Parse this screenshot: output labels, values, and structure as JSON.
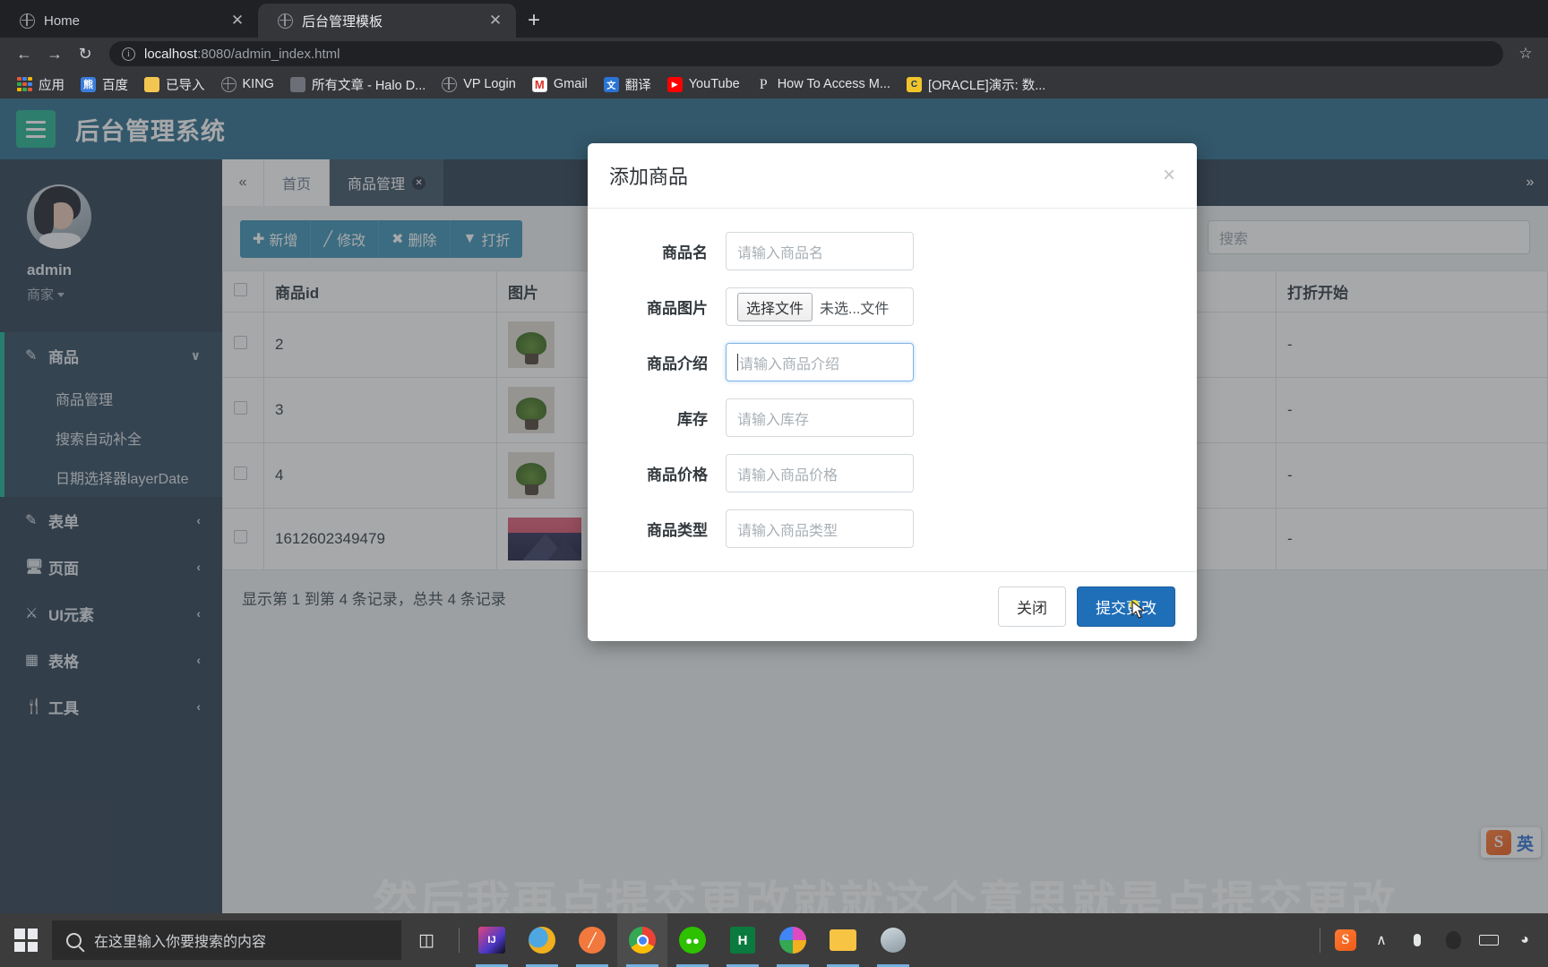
{
  "browser": {
    "tabs": [
      {
        "title": "Home",
        "active": false,
        "favicon": "globe-icon",
        "close": "✕"
      },
      {
        "title": "后台管理模板",
        "active": true,
        "favicon": "globe-icon",
        "close": "✕"
      }
    ],
    "new_tab_label": "+",
    "nav": {
      "back": "←",
      "forward": "→",
      "reload": "↻",
      "star": "☆"
    },
    "omnibox": {
      "host": "localhost",
      "path": ":8080/admin_index.html",
      "info_icon": "info-icon"
    },
    "bookmarks": [
      {
        "label": "应用",
        "icon": "apps-grid-icon"
      },
      {
        "label": "百度",
        "icon": "baidu-icon"
      },
      {
        "label": "已导入",
        "icon": "folder-icon"
      },
      {
        "label": "KING",
        "icon": "globe-icon"
      },
      {
        "label": "所有文章 - Halo D...",
        "icon": "photo-icon"
      },
      {
        "label": "VP Login",
        "icon": "globe-icon"
      },
      {
        "label": "Gmail",
        "icon": "gmail-icon"
      },
      {
        "label": "翻译",
        "icon": "translate-icon"
      },
      {
        "label": "YouTube",
        "icon": "youtube-icon"
      },
      {
        "label": "How To Access M...",
        "icon": "p-letter-icon"
      },
      {
        "label": "[ORACLE]演示: 数...",
        "icon": "oracle-icon"
      }
    ]
  },
  "app": {
    "brand": "后台管理系统",
    "hamburger_icon": "hamburger-icon",
    "sidebar": {
      "user": {
        "name": "admin",
        "role": "商家",
        "avatar": "user-avatar"
      },
      "nav": [
        {
          "label": "商品",
          "icon": "edit-square-icon",
          "arrow": "∨",
          "open": true,
          "children": [
            "商品管理",
            "搜索自动补全",
            "日期选择器layerDate"
          ]
        },
        {
          "label": "表单",
          "icon": "edit-square-icon",
          "arrow": "‹",
          "open": false,
          "children": []
        },
        {
          "label": "页面",
          "icon": "monitor-icon",
          "arrow": "‹",
          "open": false,
          "children": []
        },
        {
          "label": "UI元素",
          "icon": "flask-icon",
          "arrow": "‹",
          "open": false,
          "children": []
        },
        {
          "label": "表格",
          "icon": "table-grid-icon",
          "arrow": "‹",
          "open": false,
          "children": []
        },
        {
          "label": "工具",
          "icon": "wrench-icon",
          "arrow": "‹",
          "open": false,
          "children": []
        }
      ]
    },
    "tabnav": {
      "collapse_icon": "«",
      "expand_icon": "»",
      "items": [
        {
          "label": "首页",
          "active": false,
          "closable": false
        },
        {
          "label": "商品管理",
          "active": true,
          "closable": true,
          "close_icon": "✕"
        }
      ]
    },
    "toolbar": {
      "buttons": [
        {
          "label": "新增",
          "icon": "plus-icon"
        },
        {
          "label": "修改",
          "icon": "pencil-icon"
        },
        {
          "label": "删除",
          "icon": "x-icon"
        },
        {
          "label": "打折",
          "icon": "funnel-icon"
        }
      ],
      "search_placeholder": "搜索"
    },
    "table": {
      "columns": [
        "",
        "商品id",
        "图片",
        "",
        "",
        "打折开始"
      ],
      "rows": [
        {
          "id": "2",
          "image": "plant-thumbnail",
          "discount_start": "-"
        },
        {
          "id": "3",
          "image": "plant-thumbnail",
          "discount_start": "-"
        },
        {
          "id": "4",
          "image": "plant-thumbnail",
          "discount_start": "-"
        },
        {
          "id": "1612602349479",
          "image": "mountain-thumbnail",
          "discount_start": "-"
        }
      ]
    },
    "pager_text": "显示第 1 到第 4 条记录，总共 4 条记录",
    "subtitle": "然后我再点提交更改就就这个意思就是点提交更改",
    "ime": {
      "logo": "S",
      "mode": "英"
    }
  },
  "modal": {
    "title": "添加商品",
    "close_icon": "×",
    "fields": [
      {
        "label": "商品名",
        "type": "text",
        "placeholder": "请输入商品名",
        "value": "",
        "focused": false
      },
      {
        "label": "商品图片",
        "type": "file",
        "button_label": "选择文件",
        "file_status": "未选...文件"
      },
      {
        "label": "商品介绍",
        "type": "text",
        "placeholder": "请输入商品介绍",
        "value": "",
        "focused": true
      },
      {
        "label": "库存",
        "type": "text",
        "placeholder": "请输入库存",
        "value": "",
        "focused": false
      },
      {
        "label": "商品价格",
        "type": "text",
        "placeholder": "请输入商品价格",
        "value": "",
        "focused": false
      },
      {
        "label": "商品类型",
        "type": "text",
        "placeholder": "请输入商品类型",
        "value": "",
        "focused": false
      }
    ],
    "close_button": "关闭",
    "submit_button": "提交更改",
    "primary_color": "#1f6eb8"
  },
  "taskbar": {
    "start_icon": "windows-logo-icon",
    "search_placeholder": "在这里输入你要搜索的内容",
    "task_view_icon": "task-view-icon",
    "apps": [
      {
        "name": "intellij-idea-icon",
        "letters": "IJ",
        "color": "#2b2b4f"
      },
      {
        "name": "navicat-icon",
        "letters": "",
        "color": "#f2b01e"
      },
      {
        "name": "orange-pen-icon",
        "letters": "",
        "color": "#f2793d"
      },
      {
        "name": "google-chrome-icon",
        "letters": "",
        "color": "#ffffff",
        "active": true
      },
      {
        "name": "wechat-icon",
        "letters": "",
        "color": "#2dc100"
      },
      {
        "name": "halo-h-icon",
        "letters": "H",
        "color": "#0b7a3e"
      },
      {
        "name": "chrome-canary-icon",
        "letters": "",
        "color": "#e04ac0"
      },
      {
        "name": "file-explorer-icon",
        "letters": "",
        "color": "#f8c444"
      },
      {
        "name": "user-photo-icon",
        "letters": "",
        "color": "#8c9aa2"
      }
    ],
    "tray": [
      {
        "name": "sogou-ime-icon",
        "glyph": "S"
      },
      {
        "name": "chevron-up-icon",
        "glyph": "∧"
      },
      {
        "name": "microphone-icon",
        "glyph": "Ἲ4"
      },
      {
        "name": "qq-penguin-icon",
        "glyph": ""
      },
      {
        "name": "battery-icon",
        "glyph": ""
      },
      {
        "name": "wifi-icon",
        "glyph": ""
      }
    ]
  }
}
